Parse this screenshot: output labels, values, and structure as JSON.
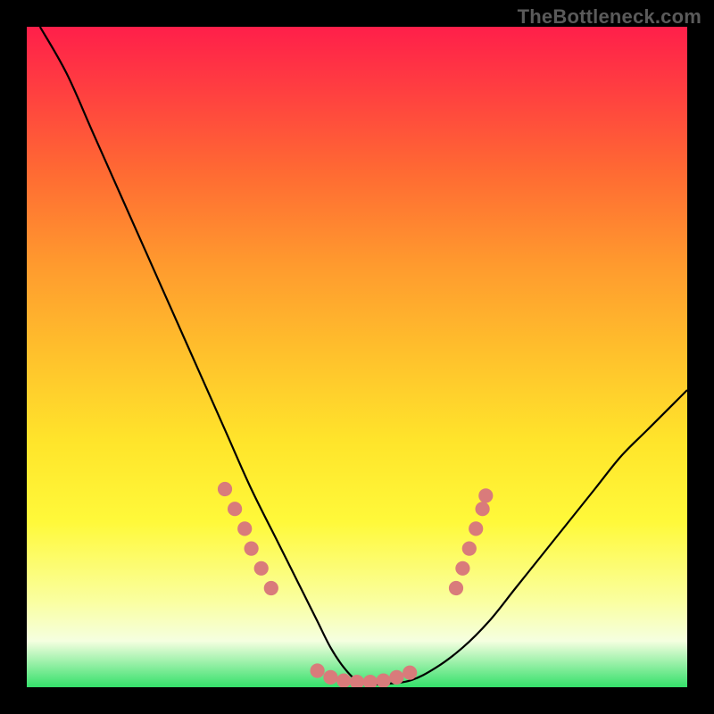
{
  "watermark": "TheBottleneck.com",
  "chart_data": {
    "type": "line",
    "title": "",
    "xlabel": "",
    "ylabel": "",
    "xlim": [
      0,
      100
    ],
    "ylim": [
      0,
      100
    ],
    "grid": false,
    "legend": false,
    "series": [
      {
        "name": "bottleneck-curve",
        "color": "#000000",
        "x": [
          2,
          6,
          10,
          14,
          18,
          22,
          26,
          30,
          34,
          38,
          40,
          42,
          44,
          46,
          48,
          50,
          52,
          54,
          58,
          62,
          66,
          70,
          74,
          78,
          82,
          86,
          90,
          94,
          98,
          100
        ],
        "y": [
          100,
          93,
          84,
          75,
          66,
          57,
          48,
          39,
          30,
          22,
          18,
          14,
          10,
          6,
          3,
          1,
          0.5,
          0.5,
          1,
          3,
          6,
          10,
          15,
          20,
          25,
          30,
          35,
          39,
          43,
          45
        ]
      }
    ],
    "markers": {
      "name": "highlight-dots",
      "color": "#d97b7b",
      "radius_pct": 1.1,
      "points": [
        {
          "x": 30,
          "y": 30
        },
        {
          "x": 31.5,
          "y": 27
        },
        {
          "x": 33,
          "y": 24
        },
        {
          "x": 34,
          "y": 21
        },
        {
          "x": 35.5,
          "y": 18
        },
        {
          "x": 37,
          "y": 15
        },
        {
          "x": 44,
          "y": 2.5
        },
        {
          "x": 46,
          "y": 1.5
        },
        {
          "x": 48,
          "y": 1
        },
        {
          "x": 50,
          "y": 0.8
        },
        {
          "x": 52,
          "y": 0.8
        },
        {
          "x": 54,
          "y": 1
        },
        {
          "x": 56,
          "y": 1.5
        },
        {
          "x": 58,
          "y": 2.2
        },
        {
          "x": 65,
          "y": 15
        },
        {
          "x": 66,
          "y": 18
        },
        {
          "x": 67,
          "y": 21
        },
        {
          "x": 68,
          "y": 24
        },
        {
          "x": 69,
          "y": 27
        },
        {
          "x": 69.5,
          "y": 29
        }
      ]
    }
  }
}
